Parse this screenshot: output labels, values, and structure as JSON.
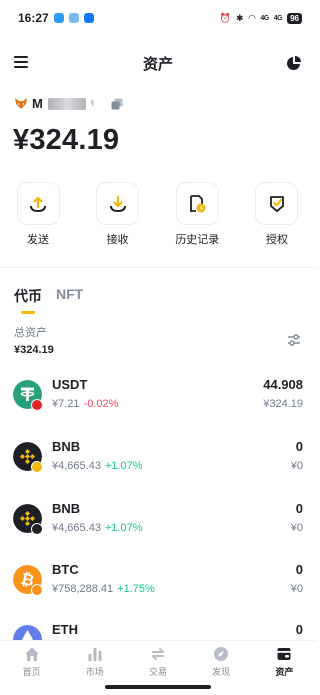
{
  "status_bar": {
    "time": "16:27",
    "battery": "96",
    "signal_1": "4G",
    "signal_2": "4G"
  },
  "header": {
    "title": "资产"
  },
  "wallet": {
    "name_prefix": "M",
    "name_suffix": "⚕"
  },
  "balance": "¥324.19",
  "actions": [
    {
      "label": "发送",
      "icon": "send-icon"
    },
    {
      "label": "接收",
      "icon": "receive-icon"
    },
    {
      "label": "历史记录",
      "icon": "history-icon"
    },
    {
      "label": "授权",
      "icon": "authorize-icon"
    }
  ],
  "tabs": [
    {
      "label": "代币"
    },
    {
      "label": "NFT"
    }
  ],
  "total": {
    "label": "总资产",
    "value": "¥324.19"
  },
  "tokens": [
    {
      "symbol": "USDT",
      "price": "¥7.21",
      "change": "-0.02%",
      "amount": "44.908",
      "value": "¥324.19",
      "color": "#26a17b",
      "badge_color": "#e0242a"
    },
    {
      "symbol": "BNB",
      "price": "¥4,665.43",
      "change": "+1.07%",
      "amount": "0",
      "value": "¥0",
      "color": "#1e2026",
      "badge_color": "#f0b90b"
    },
    {
      "symbol": "BNB",
      "price": "¥4,665.43",
      "change": "+1.07%",
      "amount": "0",
      "value": "¥0",
      "color": "#1e2026",
      "badge_color": "#1e2026"
    },
    {
      "symbol": "BTC",
      "price": "¥758,288.41",
      "change": "+1.75%",
      "amount": "0",
      "value": "¥0",
      "color": "#f7931a",
      "badge_color": "#f7931a"
    },
    {
      "symbol": "ETH",
      "color": "#627eea",
      "amount": "0"
    }
  ],
  "bottom_nav": [
    {
      "label": "首页",
      "icon": "home-icon"
    },
    {
      "label": "市场",
      "icon": "market-icon"
    },
    {
      "label": "交易",
      "icon": "trade-icon"
    },
    {
      "label": "发现",
      "icon": "discover-icon"
    },
    {
      "label": "资产",
      "icon": "wallet-icon",
      "active": true
    }
  ],
  "colors": {
    "accent": "#f0b90b",
    "up": "#0ecb81",
    "down": "#f6465d",
    "text": "#1e2026",
    "muted": "#707a8a"
  }
}
